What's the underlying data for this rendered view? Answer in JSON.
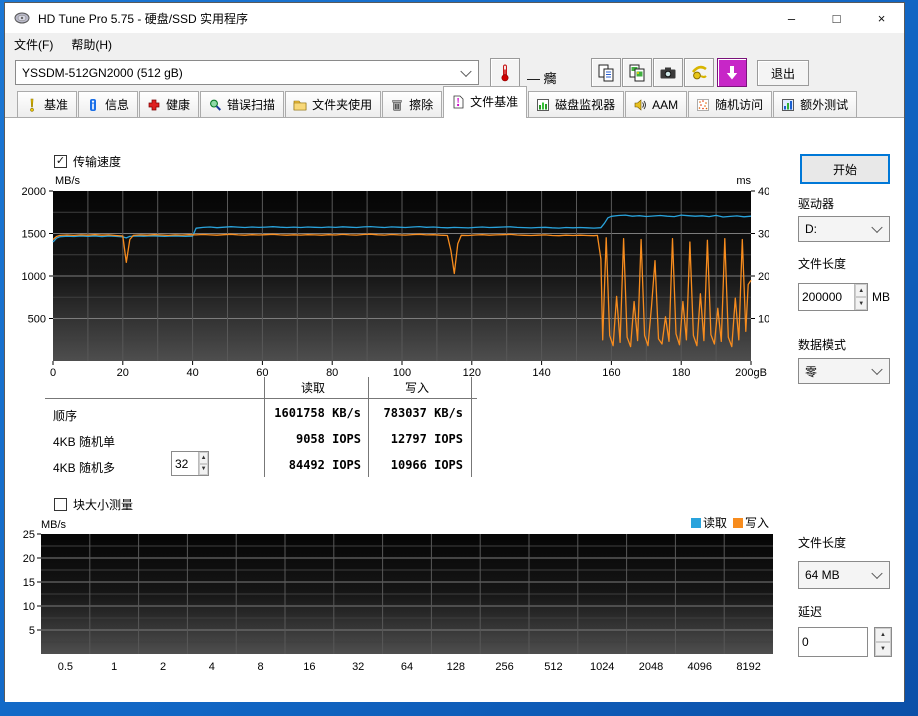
{
  "window": {
    "title": "HD Tune Pro 5.75 - 硬盘/SSD 实用程序",
    "controls": {
      "minimize": "–",
      "maximize": "□",
      "close": "×"
    }
  },
  "menu": {
    "items": [
      {
        "label": "文件(F)"
      },
      {
        "label": "帮助(H)"
      }
    ]
  },
  "toolbar": {
    "device_value": "YSSDM-512GN2000 (512 gB)",
    "temperature": "— 癵",
    "exit_label": "退出",
    "icons": [
      "thermometer-icon",
      "copy-text-icon",
      "copy-image-icon",
      "screenshot-icon",
      "donate-icon",
      "update-icon"
    ]
  },
  "tabs": [
    {
      "label": "基准",
      "icon": "benchmark-icon"
    },
    {
      "label": "信息",
      "icon": "info-icon"
    },
    {
      "label": "健康",
      "icon": "health-icon"
    },
    {
      "label": "错误扫描",
      "icon": "error-scan-icon"
    },
    {
      "label": "文件夹使用",
      "icon": "folder-usage-icon"
    },
    {
      "label": "擦除",
      "icon": "erase-icon"
    },
    {
      "label": "文件基准",
      "icon": "file-benchmark-icon",
      "active": true
    },
    {
      "label": "磁盘监视器",
      "icon": "disk-monitor-icon"
    },
    {
      "label": "AAM",
      "icon": "aam-icon"
    },
    {
      "label": "随机访问",
      "icon": "random-access-icon"
    },
    {
      "label": "额外测试",
      "icon": "extra-tests-icon"
    }
  ],
  "file_benchmark": {
    "transfer_speed_label": "传输速度",
    "transfer_speed_checked": true,
    "block_size_label": "块大小测量",
    "block_size_checked": false,
    "results": {
      "headers": [
        "读取",
        "写入"
      ],
      "rows": [
        {
          "label": "顺序",
          "read": "1601758 KB/s",
          "write": "783037 KB/s"
        },
        {
          "label": "4KB 随机单",
          "read": "9058 IOPS",
          "write": "12797 IOPS"
        },
        {
          "label": "4KB 随机多",
          "queue": "32",
          "read": "84492 IOPS",
          "write": "10966 IOPS"
        }
      ]
    },
    "legend": [
      {
        "label": "读取",
        "color": "#29a3dc"
      },
      {
        "label": "写入",
        "color": "#f78c1e"
      }
    ]
  },
  "controls": {
    "start": "开始",
    "drive_label": "驱动器",
    "drive_value": "D:",
    "file_length_label": "文件长度",
    "file_length_value": "200000",
    "file_length_unit": "MB",
    "data_mode_label": "数据模式",
    "data_mode_value": "零",
    "file_length2_label": "文件长度",
    "file_length2_value": "64 MB",
    "delay_label": "延迟",
    "delay_value": "0"
  },
  "chart_data": [
    {
      "type": "line",
      "name": "transfer-speed",
      "ylabel": "MB/s",
      "y2label": "ms",
      "xlim": [
        0,
        200
      ],
      "ylim": [
        0,
        2000
      ],
      "y2lim": [
        0,
        40
      ],
      "xticks": [
        "0",
        "20",
        "40",
        "60",
        "80",
        "100",
        "120",
        "140",
        "160",
        "180",
        "200gB"
      ],
      "yticks": [
        500,
        1000,
        1500,
        2000
      ],
      "y2ticks": [
        10,
        20,
        30,
        40
      ],
      "grid": true,
      "series": [
        {
          "name": "读取",
          "color": "#29a3dc",
          "points": [
            [
              0,
              1400
            ],
            [
              1,
              1445
            ],
            [
              2,
              1462
            ],
            [
              4,
              1468
            ],
            [
              6,
              1465
            ],
            [
              8,
              1470
            ],
            [
              10,
              1466
            ],
            [
              12,
              1471
            ],
            [
              14,
              1464
            ],
            [
              16,
              1470
            ],
            [
              18,
              1466
            ],
            [
              20,
              1460
            ],
            [
              21,
              1448
            ],
            [
              22,
              1466
            ],
            [
              24,
              1470
            ],
            [
              26,
              1468
            ],
            [
              28,
              1472
            ],
            [
              30,
              1469
            ],
            [
              32,
              1466
            ],
            [
              34,
              1471
            ],
            [
              36,
              1469
            ],
            [
              38,
              1466
            ],
            [
              40,
              1469
            ],
            [
              41,
              1562
            ],
            [
              43,
              1572
            ],
            [
              45,
              1576
            ],
            [
              47,
              1568
            ],
            [
              49,
              1574
            ],
            [
              51,
              1580
            ],
            [
              53,
              1575
            ],
            [
              55,
              1570
            ],
            [
              57,
              1576
            ],
            [
              59,
              1572
            ],
            [
              61,
              1575
            ],
            [
              63,
              1580
            ],
            [
              65,
              1574
            ],
            [
              67,
              1570
            ],
            [
              69,
              1575
            ],
            [
              71,
              1571
            ],
            [
              73,
              1576
            ],
            [
              75,
              1573
            ],
            [
              77,
              1570
            ],
            [
              79,
              1576
            ],
            [
              81,
              1572
            ],
            [
              83,
              1579
            ],
            [
              85,
              1574
            ],
            [
              87,
              1571
            ],
            [
              89,
              1578
            ],
            [
              91,
              1581
            ],
            [
              93,
              1575
            ],
            [
              95,
              1571
            ],
            [
              97,
              1578
            ],
            [
              99,
              1574
            ],
            [
              101,
              1571
            ],
            [
              103,
              1577
            ],
            [
              105,
              1581
            ],
            [
              107,
              1573
            ],
            [
              109,
              1576
            ],
            [
              111,
              1570
            ],
            [
              113,
              1567
            ],
            [
              115,
              1572
            ],
            [
              117,
              1569
            ],
            [
              119,
              1566
            ],
            [
              121,
              1572
            ],
            [
              123,
              1576
            ],
            [
              125,
              1570
            ],
            [
              127,
              1573
            ],
            [
              129,
              1576
            ],
            [
              131,
              1579
            ],
            [
              133,
              1572
            ],
            [
              135,
              1569
            ],
            [
              137,
              1566
            ],
            [
              139,
              1570
            ],
            [
              141,
              1573
            ],
            [
              143,
              1567
            ],
            [
              145,
              1564
            ],
            [
              147,
              1570
            ],
            [
              149,
              1567
            ],
            [
              151,
              1570
            ],
            [
              153,
              1567
            ],
            [
              155,
              1564
            ],
            [
              157,
              1568
            ],
            [
              158,
              1620
            ],
            [
              159,
              1685
            ],
            [
              160,
              1702
            ],
            [
              162,
              1712
            ],
            [
              164,
              1716
            ],
            [
              166,
              1704
            ],
            [
              168,
              1709
            ],
            [
              170,
              1700
            ],
            [
              172,
              1706
            ],
            [
              174,
              1712
            ],
            [
              176,
              1704
            ],
            [
              178,
              1699
            ],
            [
              180,
              1716
            ],
            [
              182,
              1709
            ],
            [
              184,
              1703
            ],
            [
              186,
              1708
            ],
            [
              188,
              1699
            ],
            [
              190,
              1713
            ],
            [
              192,
              1694
            ],
            [
              194,
              1701
            ],
            [
              196,
              1707
            ],
            [
              198,
              1697
            ],
            [
              200,
              1704
            ]
          ]
        },
        {
          "name": "写入",
          "color": "#f78c1e",
          "points": [
            [
              0,
              1430
            ],
            [
              1,
              1465
            ],
            [
              2,
              1478
            ],
            [
              4,
              1482
            ],
            [
              6,
              1478
            ],
            [
              8,
              1484
            ],
            [
              10,
              1480
            ],
            [
              12,
              1486
            ],
            [
              14,
              1480
            ],
            [
              16,
              1483
            ],
            [
              18,
              1477
            ],
            [
              20,
              1470
            ],
            [
              21,
              1160
            ],
            [
              22,
              1430
            ],
            [
              23,
              1478
            ],
            [
              25,
              1484
            ],
            [
              27,
              1480
            ],
            [
              29,
              1486
            ],
            [
              31,
              1482
            ],
            [
              33,
              1478
            ],
            [
              35,
              1484
            ],
            [
              37,
              1481
            ],
            [
              39,
              1486
            ],
            [
              41,
              1483
            ],
            [
              43,
              1488
            ],
            [
              45,
              1484
            ],
            [
              47,
              1480
            ],
            [
              49,
              1486
            ],
            [
              51,
              1490
            ],
            [
              53,
              1484
            ],
            [
              55,
              1480
            ],
            [
              57,
              1486
            ],
            [
              59,
              1482
            ],
            [
              61,
              1486
            ],
            [
              63,
              1490
            ],
            [
              65,
              1484
            ],
            [
              67,
              1480
            ],
            [
              69,
              1485
            ],
            [
              71,
              1481
            ],
            [
              73,
              1486
            ],
            [
              75,
              1483
            ],
            [
              77,
              1480
            ],
            [
              79,
              1486
            ],
            [
              81,
              1482
            ],
            [
              83,
              1489
            ],
            [
              85,
              1484
            ],
            [
              87,
              1481
            ],
            [
              89,
              1488
            ],
            [
              91,
              1492
            ],
            [
              93,
              1485
            ],
            [
              95,
              1481
            ],
            [
              97,
              1488
            ],
            [
              99,
              1484
            ],
            [
              101,
              1481
            ],
            [
              103,
              1487
            ],
            [
              105,
              1491
            ],
            [
              107,
              1483
            ],
            [
              109,
              1486
            ],
            [
              111,
              1480
            ],
            [
              113,
              1477
            ],
            [
              114,
              1300
            ],
            [
              115,
              1030
            ],
            [
              116,
              1380
            ],
            [
              117,
              1479
            ],
            [
              119,
              1476
            ],
            [
              121,
              1482
            ],
            [
              123,
              1486
            ],
            [
              125,
              1480
            ],
            [
              127,
              1483
            ],
            [
              129,
              1486
            ],
            [
              131,
              1489
            ],
            [
              133,
              1482
            ],
            [
              135,
              1479
            ],
            [
              137,
              1476
            ],
            [
              139,
              1480
            ],
            [
              141,
              1483
            ],
            [
              143,
              1477
            ],
            [
              145,
              1474
            ],
            [
              147,
              1480
            ],
            [
              149,
              1477
            ],
            [
              151,
              1480
            ],
            [
              153,
              1477
            ],
            [
              155,
              1474
            ],
            [
              156,
              1478
            ],
            [
              157,
              1200
            ],
            [
              157.5,
              250
            ],
            [
              158.5,
              1450
            ],
            [
              159.5,
              300
            ],
            [
              160.5,
              180
            ],
            [
              161.5,
              760
            ],
            [
              162.5,
              220
            ],
            [
              163.5,
              1440
            ],
            [
              164.5,
              280
            ],
            [
              165.5,
              170
            ],
            [
              166.5,
              700
            ],
            [
              167.5,
              240
            ],
            [
              168.5,
              1430
            ],
            [
              169.5,
              300
            ],
            [
              170.5,
              180
            ],
            [
              171.5,
              640
            ],
            [
              172.5,
              1180
            ],
            [
              173.5,
              260
            ],
            [
              174.5,
              200
            ],
            [
              175.5,
              520
            ],
            [
              176.5,
              230
            ],
            [
              177.5,
              1440
            ],
            [
              178.5,
              320
            ],
            [
              179.5,
              190
            ],
            [
              180.5,
              700
            ],
            [
              181.5,
              250
            ],
            [
              182.5,
              1400
            ],
            [
              183.5,
              300
            ],
            [
              184.5,
              180
            ],
            [
              185.5,
              790
            ],
            [
              186.5,
              240
            ],
            [
              187.5,
              1420
            ],
            [
              188.5,
              310
            ],
            [
              189.5,
              200
            ],
            [
              190.5,
              620
            ],
            [
              191.5,
              230
            ],
            [
              192.5,
              1440
            ],
            [
              193.5,
              280
            ],
            [
              194.5,
              170
            ],
            [
              195.5,
              740
            ],
            [
              196.5,
              250
            ],
            [
              197.5,
              1430
            ],
            [
              198.5,
              350
            ],
            [
              199.2,
              900
            ],
            [
              200,
              950
            ]
          ]
        }
      ]
    },
    {
      "type": "line",
      "name": "block-size",
      "ylabel": "MB/s",
      "ylim": [
        0,
        25
      ],
      "yticks": [
        5,
        10,
        15,
        20,
        25
      ],
      "xcategories": [
        "0.5",
        "1",
        "2",
        "4",
        "8",
        "16",
        "32",
        "64",
        "128",
        "256",
        "512",
        "1024",
        "2048",
        "4096",
        "8192"
      ],
      "grid": true,
      "legend_position": "top-right",
      "series": []
    }
  ]
}
